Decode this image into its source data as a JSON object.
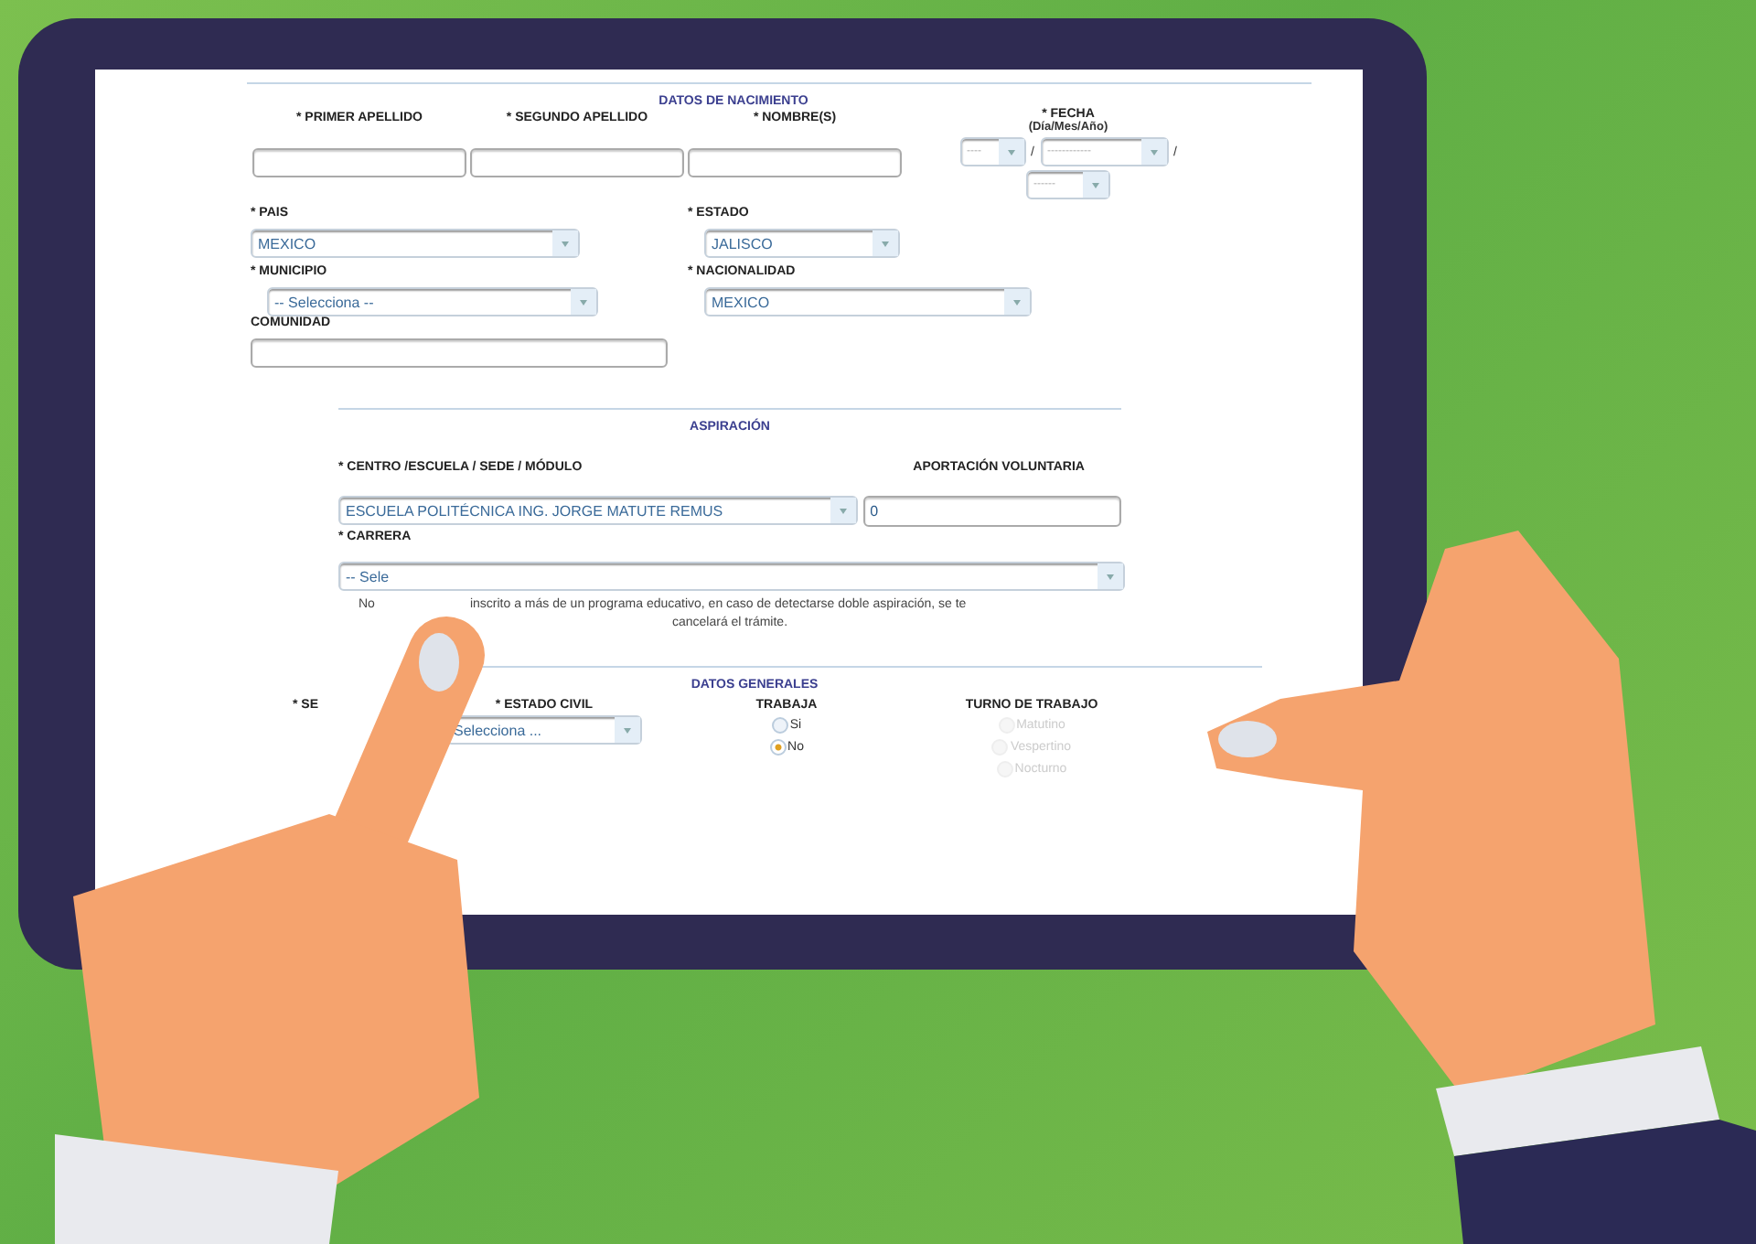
{
  "birth": {
    "title": "DATOS DE NACIMIENTO",
    "name_fields": [
      {
        "label": "* PRIMER APELLIDO"
      },
      {
        "label": "* SEGUNDO APELLIDO"
      },
      {
        "label": "* NOMBRE(S)"
      }
    ],
    "date": {
      "label": "* FECHA",
      "hint": "(Día/Mes/Año)",
      "day": "----",
      "month": "------------",
      "year": "------",
      "separators": [
        "/",
        "/"
      ]
    },
    "pais": {
      "label": "* PAIS",
      "value": "MEXICO"
    },
    "estado": {
      "label": "* ESTADO",
      "value": "JALISCO"
    },
    "municipio": {
      "label": "* MUNICIPIO",
      "value": "-- Selecciona --"
    },
    "nacionalidad": {
      "label": "* NACIONALIDAD",
      "value": "MEXICO"
    },
    "comunidad": {
      "label": "COMUNIDAD"
    }
  },
  "aspiracion": {
    "title": "ASPIRACIÓN",
    "centro": {
      "label": "* CENTRO /ESCUELA / SEDE / MÓDULO",
      "value": "ESCUELA POLITÉCNICA ING. JORGE MATUTE REMUS"
    },
    "aportacion": {
      "label": "APORTACIÓN VOLUNTARIA",
      "value": "0"
    },
    "carrera": {
      "label": "* CARRERA",
      "value": "-- Sele"
    },
    "note": [
      "No",
      "inscrito a más de un programa educativo, en caso de detectarse doble aspiración, se te",
      "cancelará el trámite."
    ]
  },
  "generales": {
    "title": "DATOS GENERALES",
    "sexo": {
      "label": "* SE"
    },
    "estado_civil": {
      "label": "* ESTADO CIVIL",
      "value": "Selecciona ..."
    },
    "trabaja": {
      "label": "TRABAJA",
      "options": [
        {
          "label": "Si",
          "selected": false
        },
        {
          "label": "No",
          "selected": true
        }
      ]
    },
    "turno": {
      "label": "TURNO DE TRABAJO",
      "options": [
        {
          "label": "Matutino",
          "disabled": true
        },
        {
          "label": "Vespertino",
          "disabled": true
        },
        {
          "label": "Nocturno",
          "disabled": true
        }
      ]
    }
  }
}
